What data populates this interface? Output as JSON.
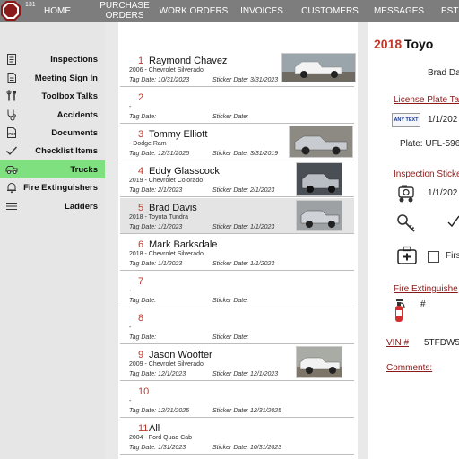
{
  "app": {
    "badge": "131"
  },
  "nav": {
    "home": "HOME",
    "purchase_orders_1": "PURCHASE",
    "purchase_orders_2": "ORDERS",
    "work_orders": "WORK ORDERS",
    "invoices": "INVOICES",
    "customers": "CUSTOMERS",
    "messages": "MESSAGES",
    "estimates": "EST"
  },
  "sidebar": {
    "items": [
      {
        "label": "Inspections",
        "icon": "clipboard-icon"
      },
      {
        "label": "Meeting Sign In",
        "icon": "meeting-doc-icon"
      },
      {
        "label": "Toolbox Talks",
        "icon": "tools-icon"
      },
      {
        "label": "Accidents",
        "icon": "stethoscope-icon"
      },
      {
        "label": "Documents",
        "icon": "pdf-icon"
      },
      {
        "label": "Checklist Items",
        "icon": "checkmark-icon"
      },
      {
        "label": "Trucks",
        "icon": "truck-icon"
      },
      {
        "label": "Fire Extinguishers",
        "icon": "bell-icon"
      },
      {
        "label": "Ladders",
        "icon": "menu-icon"
      }
    ]
  },
  "trucks": {
    "tag_label": "Tag Date:",
    "sticker_label": "Sticker Date:",
    "rows": [
      {
        "num": "1",
        "name": "Raymond Chavez",
        "vehicle": "2006 - Chevrolet Silverado",
        "tag": "10/31/2023",
        "sticker": "3/31/2023",
        "photo": "white-pickup"
      },
      {
        "num": "2",
        "name": "",
        "vehicle": "-",
        "tag": "",
        "sticker": "",
        "photo": ""
      },
      {
        "num": "3",
        "name": "Tommy Elliott",
        "vehicle": "- Dodge Ram",
        "tag": "12/31/2025",
        "sticker": "3/31/2019",
        "photo": "silver-pickup"
      },
      {
        "num": "4",
        "name": "Eddy Glasscock",
        "vehicle": "2019 - Chevrolet Colorado",
        "tag": "2/1/2023",
        "sticker": "2/1/2023",
        "photo": "silver-pickup"
      },
      {
        "num": "5",
        "name": "Brad Davis",
        "vehicle": "2018 - Toyota Tundra",
        "tag": "1/1/2023",
        "sticker": "1/1/2023",
        "photo": "silver-pickup"
      },
      {
        "num": "6",
        "name": "Mark Barksdale",
        "vehicle": "2018 - Chevrolet Silverado",
        "tag": "1/1/2023",
        "sticker": "1/1/2023",
        "photo": ""
      },
      {
        "num": "7",
        "name": "",
        "vehicle": "-",
        "tag": "",
        "sticker": "",
        "photo": ""
      },
      {
        "num": "8",
        "name": "",
        "vehicle": "-",
        "tag": "",
        "sticker": "",
        "photo": ""
      },
      {
        "num": "9",
        "name": "Jason Woofter",
        "vehicle": "2009 - Chevrolet Silverado",
        "tag": "12/1/2023",
        "sticker": "12/1/2023",
        "photo": "white-pickup"
      },
      {
        "num": "10",
        "name": "",
        "vehicle": "-",
        "tag": "12/31/2025",
        "sticker": "12/31/2025",
        "photo": ""
      },
      {
        "num": "11",
        "name": "All",
        "vehicle": "2004 - Ford Quad Cab",
        "tag": "1/31/2023",
        "sticker": "10/31/2023",
        "photo": ""
      }
    ]
  },
  "detail": {
    "year": "2018",
    "make": "Toyo",
    "driver": "Brad Da",
    "license_heading": "License Plate Ta",
    "plate_badge": "ANY TEXT",
    "license_date": "1/1/202",
    "plate": "Plate: UFL-596",
    "inspection_heading": "Inspection Sticke",
    "inspection_date": "1/1/202",
    "first_aid_label": "Firs",
    "fire_heading": "Fire Extinguishe",
    "fire_value": "#",
    "vin_label": "VIN #",
    "vin_value": "5TFDW5",
    "comments_label": "Comments:"
  }
}
